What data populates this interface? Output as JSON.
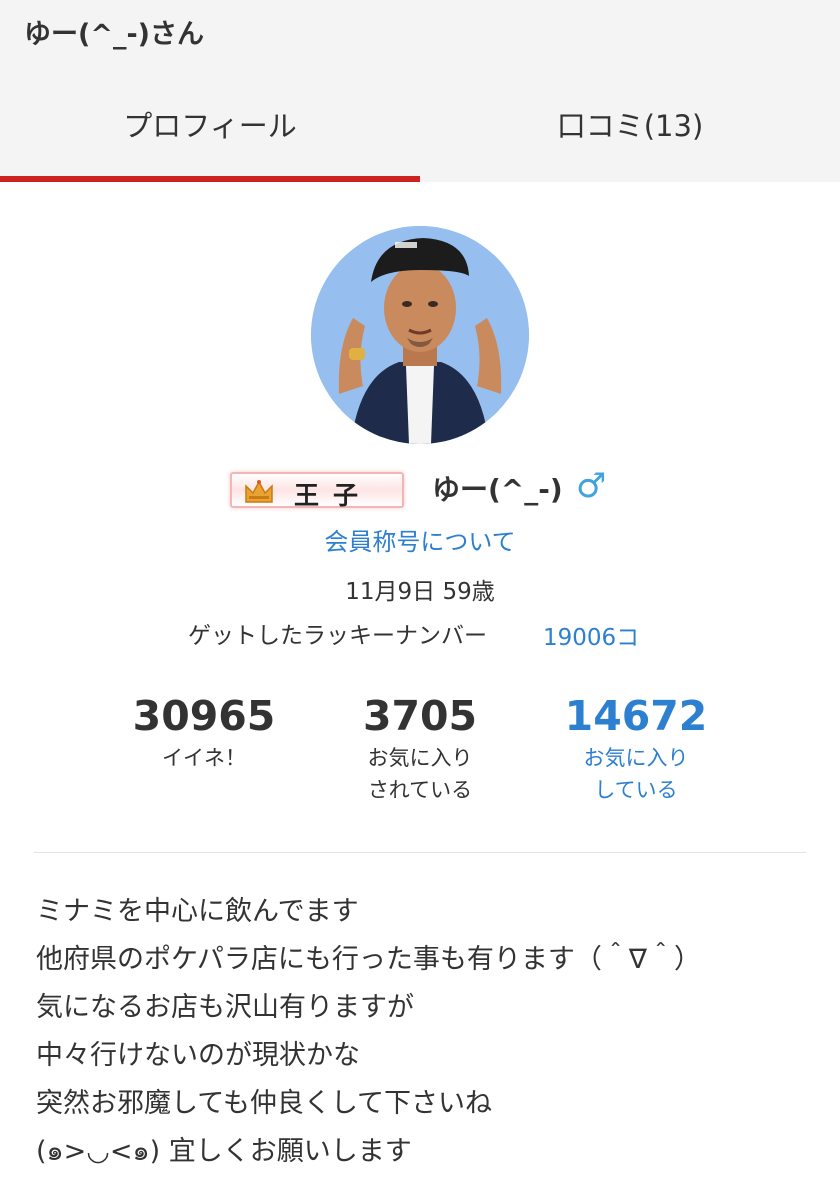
{
  "header": {
    "title": "ゆー(^_-)さん",
    "tabs": [
      {
        "label": "プロフィール",
        "active": true
      },
      {
        "label": "口コミ(13)",
        "active": false
      }
    ],
    "active_color": "#cc2222"
  },
  "profile": {
    "avatar_icon": "3d-avatar-cap-man",
    "rank_badge": "王子",
    "rank_icon": "crown-icon",
    "name": "ゆー(^_-)",
    "gender_symbol": "♂",
    "title_link": "会員称号について",
    "birthday": "11月9日 59歳",
    "lucky_label": "ゲットしたラッキーナンバー",
    "lucky_value": "19006コ"
  },
  "stats": [
    {
      "value": "30965",
      "label_lines": [
        "イイネ！"
      ],
      "link": false
    },
    {
      "value": "3705",
      "label_lines": [
        "お気に入り",
        "されている"
      ],
      "link": false
    },
    {
      "value": "14672",
      "label_lines": [
        "お気に入り",
        "している"
      ],
      "link": true
    }
  ],
  "bio": [
    "ミナミを中心に飲んでます",
    "他府県のポケパラ店にも行った事も有ります（＾∇＾）",
    "気になるお店も沢山有りますが",
    "中々行けないのが現状かな",
    "突然お邪魔しても仲良くして下さいね",
    "(๑>◡<๑) 宜しくお願いします"
  ],
  "colors": {
    "link": "#2d7fd0",
    "gender": "#3fa3e0",
    "header_bg": "#f4f4f4"
  }
}
